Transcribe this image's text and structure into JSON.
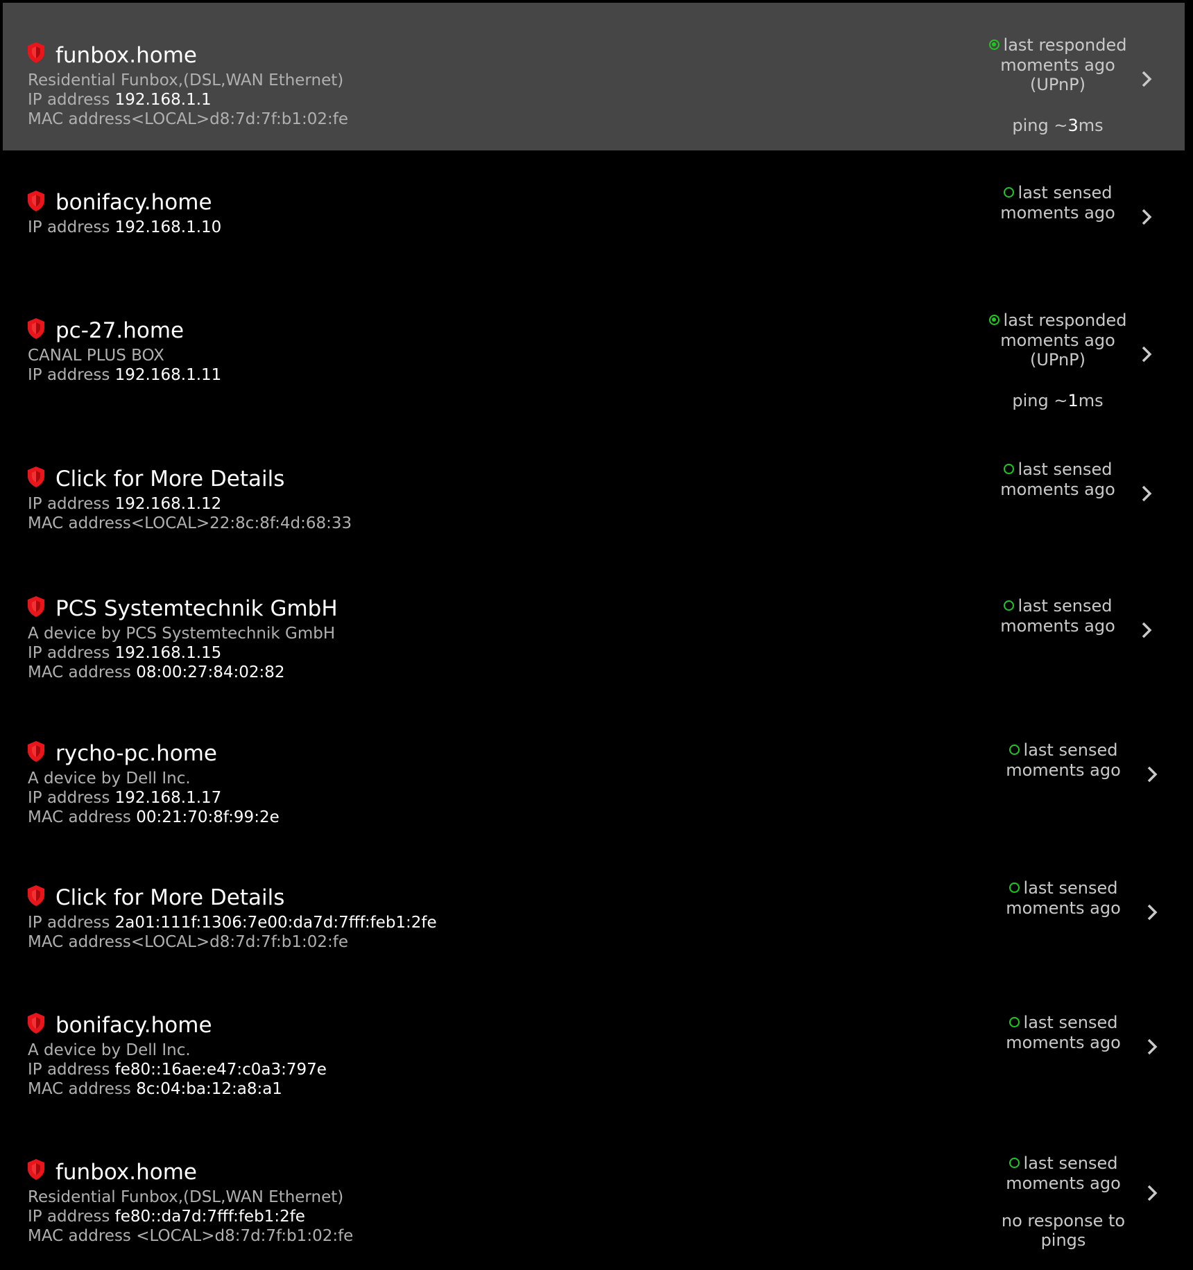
{
  "devices": [
    {
      "name": "funbox.home",
      "lines": [
        {
          "label": "Residential Funbox,(DSL,WAN Ethernet)",
          "value": ""
        },
        {
          "label": "IP address ",
          "value": "192.168.1.1"
        },
        {
          "label": "MAC address<LOCAL>d8:7d:7f:b1:02:fe",
          "value": ""
        }
      ],
      "status": {
        "type": "responded",
        "lines": [
          "last responded",
          "moments ago",
          "(UPnP)"
        ]
      },
      "ping": {
        "prefix": "ping ~",
        "number": "3",
        "suffix": "ms"
      }
    },
    {
      "name": "bonifacy.home",
      "lines": [
        {
          "label": "IP address ",
          "value": "192.168.1.10"
        }
      ],
      "status": {
        "type": "sensed",
        "lines": [
          "last sensed",
          "moments ago"
        ]
      }
    },
    {
      "name": "pc-27.home",
      "lines": [
        {
          "label": "CANAL PLUS BOX",
          "value": ""
        },
        {
          "label": "IP address ",
          "value": "192.168.1.11"
        }
      ],
      "status": {
        "type": "responded",
        "lines": [
          "last responded",
          "moments ago",
          "(UPnP)"
        ]
      },
      "ping": {
        "prefix": "ping ~",
        "number": "1",
        "suffix": "ms"
      }
    },
    {
      "name": "Click for More Details",
      "lines": [
        {
          "label": "IP address ",
          "value": "192.168.1.12"
        },
        {
          "label": "MAC address<LOCAL>22:8c:8f:4d:68:33",
          "value": ""
        }
      ],
      "status": {
        "type": "sensed",
        "lines": [
          "last sensed",
          "moments ago"
        ]
      }
    },
    {
      "name": "PCS Systemtechnik GmbH",
      "lines": [
        {
          "label": "A device by PCS Systemtechnik GmbH",
          "value": ""
        },
        {
          "label": "IP address ",
          "value": "192.168.1.15"
        },
        {
          "label": "MAC address ",
          "value": "08:00:27:84:02:82"
        }
      ],
      "status": {
        "type": "sensed",
        "lines": [
          "last sensed",
          "moments ago"
        ]
      }
    },
    {
      "name": "rycho-pc.home",
      "lines": [
        {
          "label": "A device by Dell Inc.",
          "value": ""
        },
        {
          "label": "IP address ",
          "value": "192.168.1.17"
        },
        {
          "label": "MAC address ",
          "value": "00:21:70:8f:99:2e"
        }
      ],
      "status": {
        "type": "sensed",
        "lines": [
          "last sensed",
          "moments ago"
        ]
      }
    },
    {
      "name": "Click for More Details",
      "lines": [
        {
          "label": "IP address ",
          "value": "2a01:111f:1306:7e00:da7d:7fff:feb1:2fe"
        },
        {
          "label": "MAC address<LOCAL>d8:7d:7f:b1:02:fe",
          "value": ""
        }
      ],
      "status": {
        "type": "sensed",
        "lines": [
          "last sensed",
          "moments ago"
        ]
      }
    },
    {
      "name": "bonifacy.home",
      "lines": [
        {
          "label": "A device by Dell Inc.",
          "value": ""
        },
        {
          "label": "IP address ",
          "value": "fe80::16ae:e47:c0a3:797e"
        },
        {
          "label": "MAC address ",
          "value": "8c:04:ba:12:a8:a1"
        }
      ],
      "status": {
        "type": "sensed",
        "lines": [
          "last sensed",
          "moments ago"
        ]
      }
    },
    {
      "name": "funbox.home",
      "lines": [
        {
          "label": "Residential Funbox,(DSL,WAN Ethernet)",
          "value": ""
        },
        {
          "label": "IP address ",
          "value": "fe80::da7d:7fff:feb1:2fe"
        },
        {
          "label": "MAC address <LOCAL>d8:7d:7f:b1:02:fe",
          "value": ""
        }
      ],
      "status": {
        "type": "sensed",
        "lines": [
          "last sensed",
          "moments ago"
        ]
      },
      "note": [
        "no response to",
        "pings"
      ]
    }
  ],
  "icons": {
    "row_icon": "shield-icon",
    "row_chevron": "chevron-right-icon"
  },
  "colors": {
    "shield": "#e8151b",
    "status_dot": "#1ec81e",
    "selected_row": "#464646",
    "background": "#000000"
  }
}
